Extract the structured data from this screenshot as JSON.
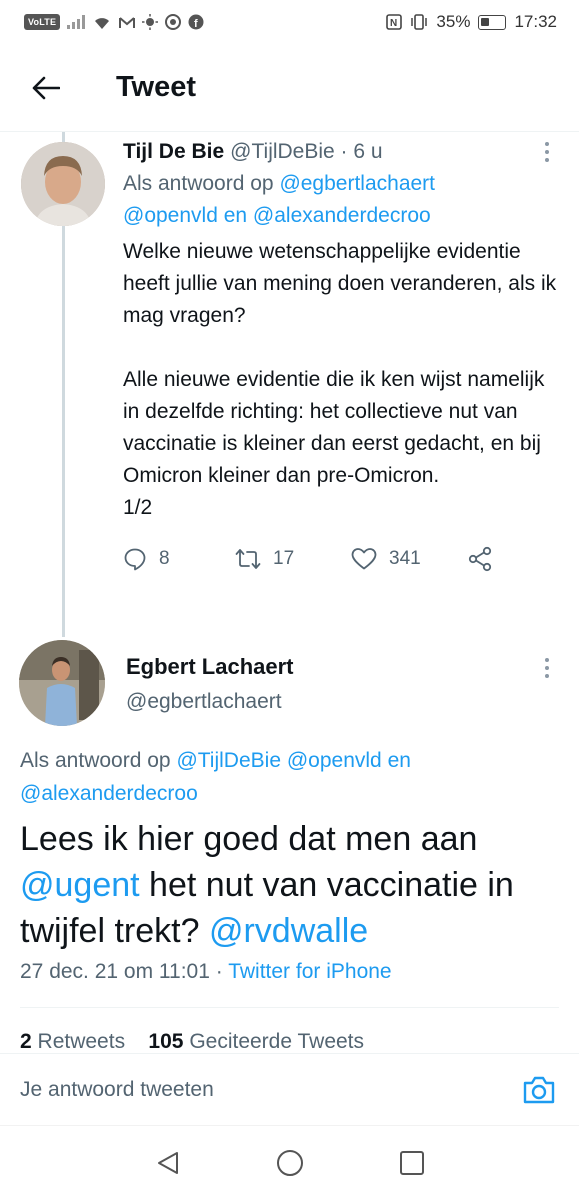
{
  "status_bar": {
    "volte": "VoLTE",
    "battery": "35%",
    "time": "17:32"
  },
  "header": {
    "title": "Tweet"
  },
  "reply_tweet": {
    "name": "Tijl De Bie",
    "handle": "@TijlDeBie · 6 u",
    "replying_prefix": "Als antwoord op ",
    "replying_mention1": "@egbertlachaert",
    "replying_mention2": "@openvld",
    "replying_and": " en ",
    "replying_mention3": "@alexanderdecroo",
    "text": "Welke nieuwe wetenschappelijke evidentie heeft jullie van mening doen veranderen, als ik mag vragen?\n\nAlle nieuwe evidentie die ik ken wijst namelijk in dezelfde richting: het collectieve nut van vaccinatie is kleiner dan eerst gedacht, en bij Omicron kleiner dan pre-Omicron.\n1/2",
    "reply_count": "8",
    "retweet_count": "17",
    "like_count": "341"
  },
  "main_tweet": {
    "name": "Egbert Lachaert",
    "handle": "@egbertlachaert",
    "replying_prefix": "Als antwoord op ",
    "replying_mention1": "@TijlDeBie",
    "replying_mention2": "@openvld",
    "replying_and": " en ",
    "replying_mention3": "@alexanderdecroo",
    "text_part1": "Lees ik hier goed dat men aan ",
    "text_mention1": "@ugent",
    "text_part2": " het nut van vaccinatie in twijfel trekt? ",
    "text_mention2": "@rvdwalle",
    "date": "27 dec. 21 om 11:01 · ",
    "source": "Twitter for iPhone",
    "retweets_count": "2",
    "retweets_label": "Retweets",
    "quotes_count": "105",
    "quotes_label": "Geciteerde Tweets"
  },
  "compose": {
    "placeholder": "Je antwoord tweeten"
  },
  "colors": {
    "accent": "#1d9bf0",
    "text": "#0f1419",
    "secondary": "#536471"
  }
}
